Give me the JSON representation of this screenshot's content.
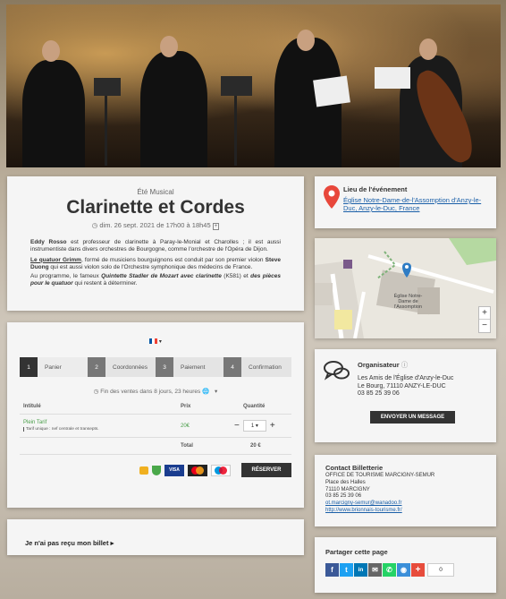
{
  "hero": {
    "alt": "concert photo"
  },
  "event": {
    "category": "Été Musical",
    "title": "Clarinette et Cordes",
    "datetime": "dim. 26 sept. 2021 de 17h00 à 18h45",
    "p1_name": "Eddy Rosso",
    "p1_text": " est professeur de clarinette à Paray-le-Monial et Charolles ; il est aussi instrumentiste dans divers orchestres de Bourgogne, comme l'orchestre de l'Opéra de Dijon.",
    "p2_name": "Le quatuor Grimm",
    "p2_text": ", formé de musiciens bourguignons est conduit par son premier violon ",
    "p2_name2": "Steve Duong",
    "p2_text2": " qui est aussi violon solo de l'Orchestre symphonique des médecins de France.",
    "p3_a": "Au programme, le fameux ",
    "p3_b": "Quintette Stadler de Mozart avec clarinette",
    "p3_c": " (K581) et ",
    "p3_d": "des pièces pour le quatuor",
    "p3_e": " qui restent à déterminer."
  },
  "location": {
    "heading": "Lieu de l'événement",
    "link": "Église Notre-Dame-de-l'Assomption d'Anzy-le-Duc, Anzy-le-Duc, France",
    "map_label": "Église Notre-Dame de l'Assomption",
    "zoom_in": "+",
    "zoom_out": "−"
  },
  "booking": {
    "lang_flag": "FR",
    "steps": [
      {
        "num": "1",
        "label": "Panier"
      },
      {
        "num": "2",
        "label": "Coordonnées"
      },
      {
        "num": "3",
        "label": "Paiement"
      },
      {
        "num": "4",
        "label": "Confirmation"
      }
    ],
    "countdown": "Fin des ventes dans 8 jours, 23 heures",
    "col_intitule": "Intitulé",
    "col_prix": "Prix",
    "col_quantite": "Quantité",
    "ticket_name": "Plein Tarif",
    "ticket_desc": "Tarif unique : nef centrale et transepts.",
    "ticket_price": "20€",
    "qty_value": "1",
    "total_label": "Total",
    "total_value": "20 €",
    "reserve_label": "RÉSERVER",
    "cards": [
      "VISA",
      "MC",
      "Maestro"
    ]
  },
  "organizer": {
    "heading": "Organisateur",
    "name": "Les Amis de l'Église d'Anzy-le-Duc",
    "address": "Le Bourg, 71110 ANZY-LE-DUC",
    "phone": "03 85 25 39 06",
    "message_button": "ENVOYER UN MESSAGE"
  },
  "contact": {
    "heading": "Contact Billetterie",
    "org": "OFFICE DE TOURISME MARCIGNY-SEMUR",
    "street": "Place des Halles",
    "city": "71110 MARCIGNY",
    "phone": "03 85 25 39 06",
    "email": "ot.marcigny-semur@wanadoo.fr",
    "website": "http://www.brionnais-tourisme.fr/"
  },
  "ticket_missing": {
    "label": "Je n'ai pas reçu mon billet"
  },
  "share": {
    "heading": "Partager cette page",
    "count": "0",
    "buttons": [
      {
        "name": "facebook",
        "glyph": "f",
        "color": "#3b5998"
      },
      {
        "name": "twitter",
        "glyph": "t",
        "color": "#1da1f2"
      },
      {
        "name": "linkedin",
        "glyph": "in",
        "color": "#0077b5"
      },
      {
        "name": "email",
        "glyph": "✉",
        "color": "#666666"
      },
      {
        "name": "whatsapp",
        "glyph": "✆",
        "color": "#25d366"
      },
      {
        "name": "qzone",
        "glyph": "◉",
        "color": "#3b8fd9"
      },
      {
        "name": "more",
        "glyph": "+",
        "color": "#e74c3c"
      }
    ]
  }
}
